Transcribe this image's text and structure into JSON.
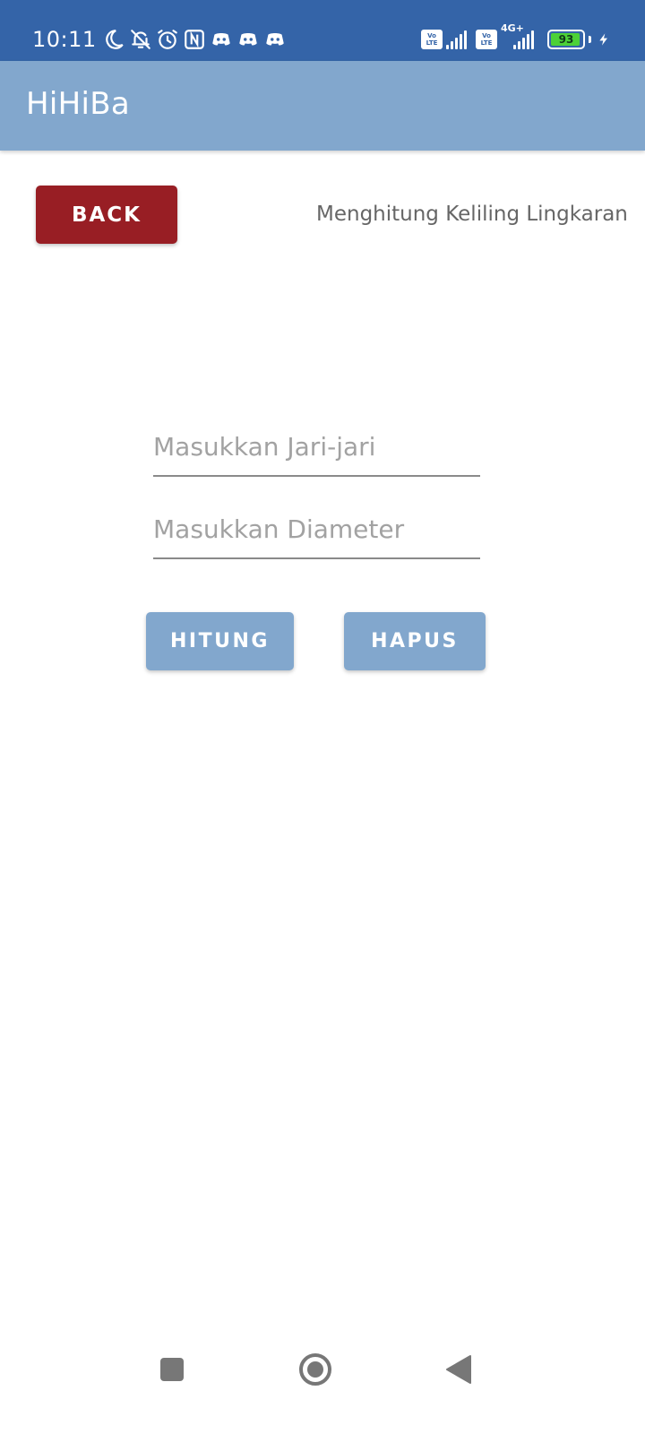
{
  "status_bar": {
    "time": "10:11",
    "left_icons": [
      "moon-icon",
      "bell-off-icon",
      "alarm-icon",
      "nfc-icon",
      "discord-icon",
      "discord-icon",
      "discord-icon"
    ],
    "volte_label_top": "Vo",
    "volte_label_bottom": "LTE",
    "network_type": "4G+",
    "battery_level": "93",
    "battery_fraction": 0.93,
    "charging": true,
    "background_color": "#3464A8"
  },
  "app_bar": {
    "title": "HiHiBa",
    "background_color": "#82A7CD"
  },
  "content": {
    "back_label": "BACK",
    "back_color": "#981E24",
    "heading": "Menghitung Keliling Lingkaran",
    "radius_input": {
      "placeholder": "Masukkan Jari-jari",
      "value": ""
    },
    "diameter_input": {
      "placeholder": "Masukkan Diameter",
      "value": ""
    },
    "calc_label": "HITUNG",
    "clear_label": "HAPUS",
    "button_color": "#82A7CD"
  },
  "nav_bar": {
    "buttons": [
      "recent-apps-icon",
      "home-icon",
      "back-icon"
    ],
    "icon_color": "#777777"
  }
}
